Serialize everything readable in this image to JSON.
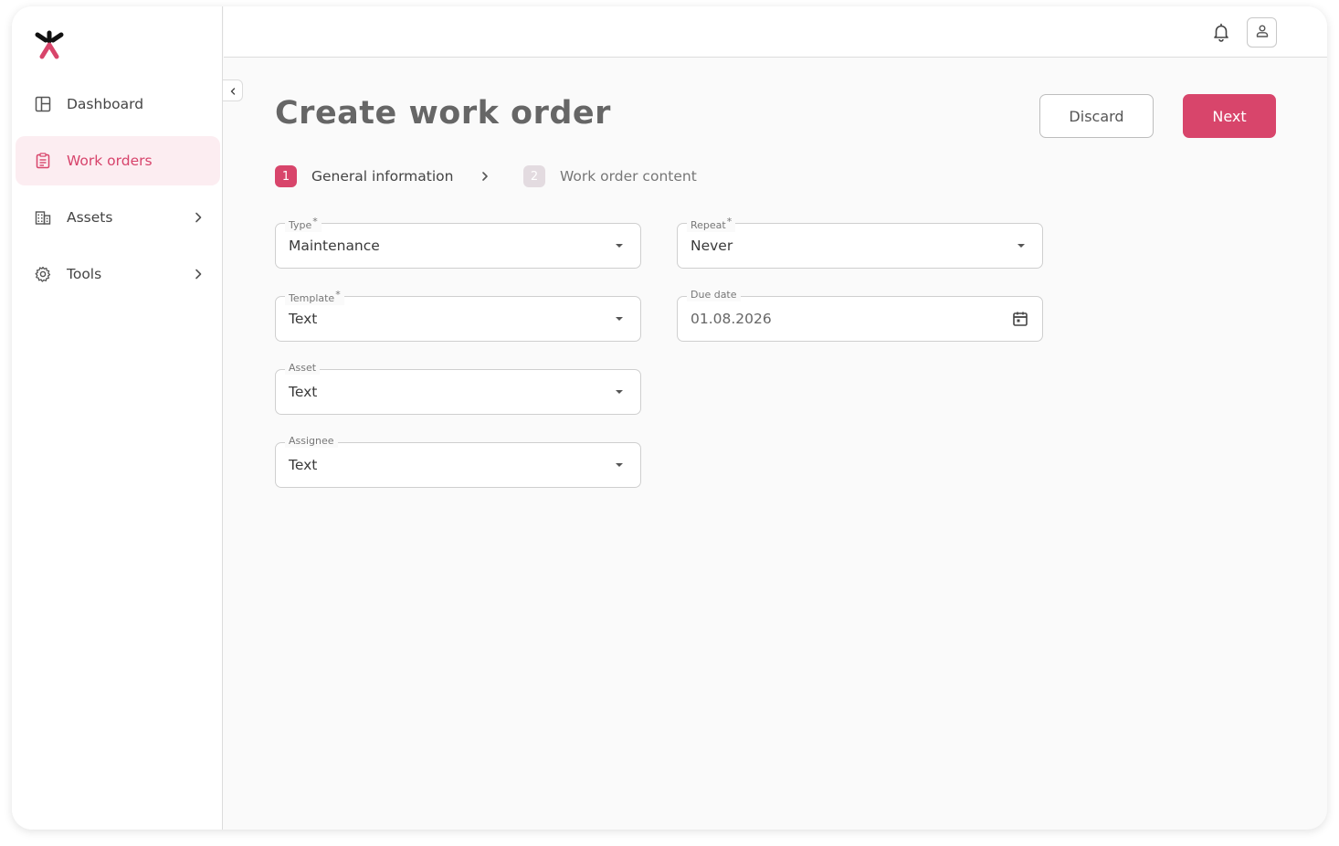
{
  "sidebar": {
    "items": [
      {
        "label": "Dashboard",
        "icon": "dashboard-icon"
      },
      {
        "label": "Work orders",
        "icon": "clipboard-icon",
        "active": true
      },
      {
        "label": "Assets",
        "icon": "building-icon",
        "has_children": true
      },
      {
        "label": "Tools",
        "icon": "gear-icon",
        "has_children": true
      }
    ]
  },
  "header": {
    "icons": [
      "bell-icon",
      "user-icon"
    ]
  },
  "page": {
    "title": "Create work order",
    "discard_label": "Discard",
    "next_label": "Next"
  },
  "stepper": {
    "steps": [
      {
        "number": "1",
        "label": "General information",
        "active": true
      },
      {
        "number": "2",
        "label": "Work order content",
        "active": false
      }
    ]
  },
  "form": {
    "type": {
      "label": "Type",
      "required": "*",
      "value": "Maintenance"
    },
    "repeat": {
      "label": "Repeat",
      "required": "*",
      "value": "Never"
    },
    "template": {
      "label": "Template",
      "required": "*",
      "value": "Text"
    },
    "due_date": {
      "label": "Due date",
      "value": "01.08.2026"
    },
    "asset": {
      "label": "Asset",
      "value": "Text"
    },
    "assignee": {
      "label": "Assignee",
      "value": "Text"
    }
  },
  "colors": {
    "accent": "#d8456b",
    "active_bg": "#fcedf1",
    "inactive_step": "#e3dbe0"
  }
}
